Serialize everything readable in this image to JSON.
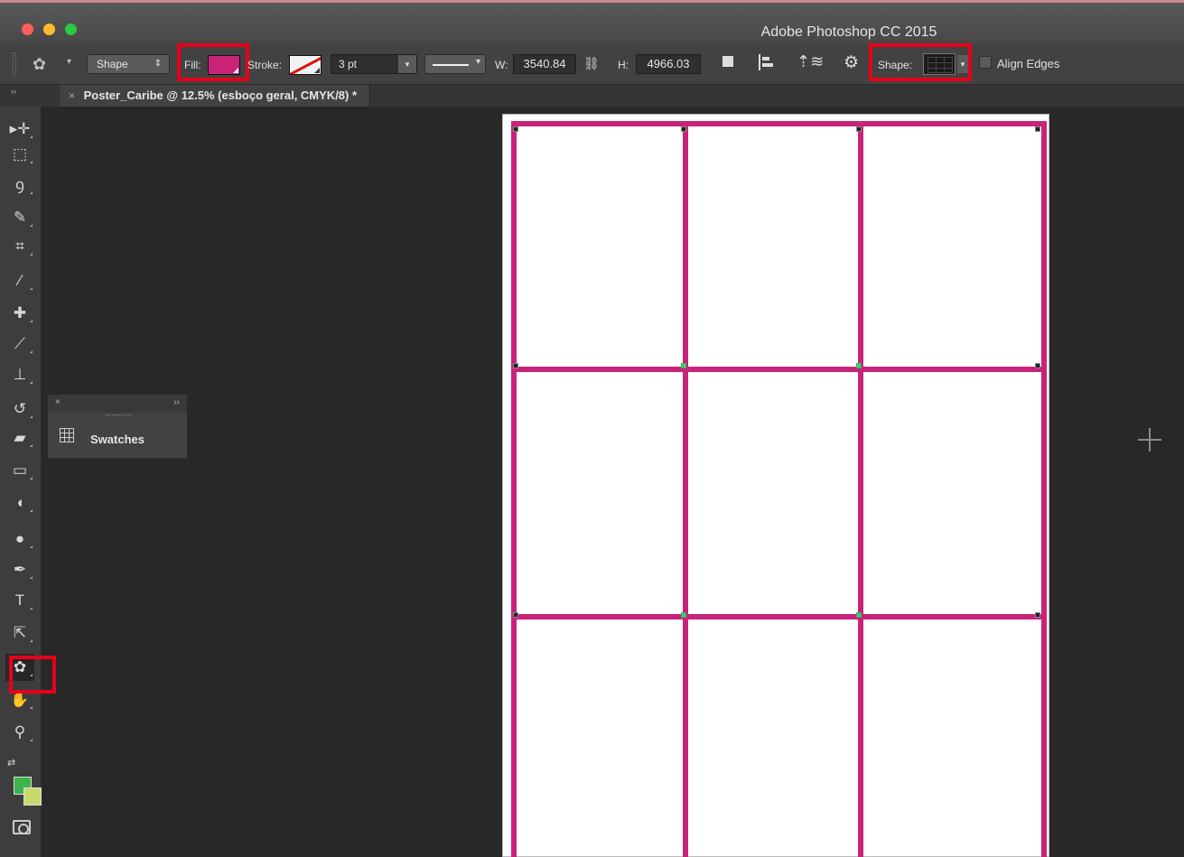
{
  "window": {
    "title": "Adobe Photoshop CC 2015"
  },
  "options_bar": {
    "mode": "Shape",
    "fill_label": "Fill:",
    "fill_color": "#c8247a",
    "stroke_label": "Stroke:",
    "stroke_width": "3 pt",
    "w_label": "W:",
    "w_value": "3540.84",
    "h_label": "H:",
    "h_value": "4966.03",
    "shape_label": "Shape:",
    "align_edges_label": "Align Edges",
    "highlight_color": "#e8001a"
  },
  "document_tab": {
    "close": "×",
    "title": "Poster_Caribe @ 12.5% (esboço geral, CMYK/8) *"
  },
  "toolbar": {
    "tools": [
      {
        "name": "move-tool",
        "glyph": "▸✛"
      },
      {
        "name": "marquee-tool",
        "glyph": "⬚"
      },
      {
        "name": "lasso-tool",
        "glyph": "ꝯ"
      },
      {
        "name": "quick-selection-tool",
        "glyph": "✎"
      },
      {
        "name": "crop-tool",
        "glyph": "⌗"
      },
      {
        "name": "eyedropper-tool",
        "glyph": "⁄"
      },
      {
        "name": "healing-brush-tool",
        "glyph": "✚"
      },
      {
        "name": "brush-tool",
        "glyph": "⟋"
      },
      {
        "name": "clone-stamp-tool",
        "glyph": "⊥"
      },
      {
        "name": "history-brush-tool",
        "glyph": "↺"
      },
      {
        "name": "eraser-tool",
        "glyph": "▰"
      },
      {
        "name": "gradient-tool",
        "glyph": "▭"
      },
      {
        "name": "blur-tool",
        "glyph": "◖"
      },
      {
        "name": "dodge-tool",
        "glyph": "●"
      },
      {
        "name": "pen-tool",
        "glyph": "✒"
      },
      {
        "name": "type-tool",
        "glyph": "T"
      },
      {
        "name": "path-selection-tool",
        "glyph": "⇱"
      },
      {
        "name": "custom-shape-tool",
        "glyph": "✿"
      },
      {
        "name": "hand-tool",
        "glyph": "✋"
      },
      {
        "name": "zoom-tool",
        "glyph": "⚲"
      }
    ],
    "foreground_color": "#3cb44b",
    "background_color": "#c6d96b"
  },
  "swatches_panel": {
    "close": "×",
    "expand": "››",
    "label": "Swatches"
  },
  "canvas": {
    "frame_color": "#c8237a"
  }
}
